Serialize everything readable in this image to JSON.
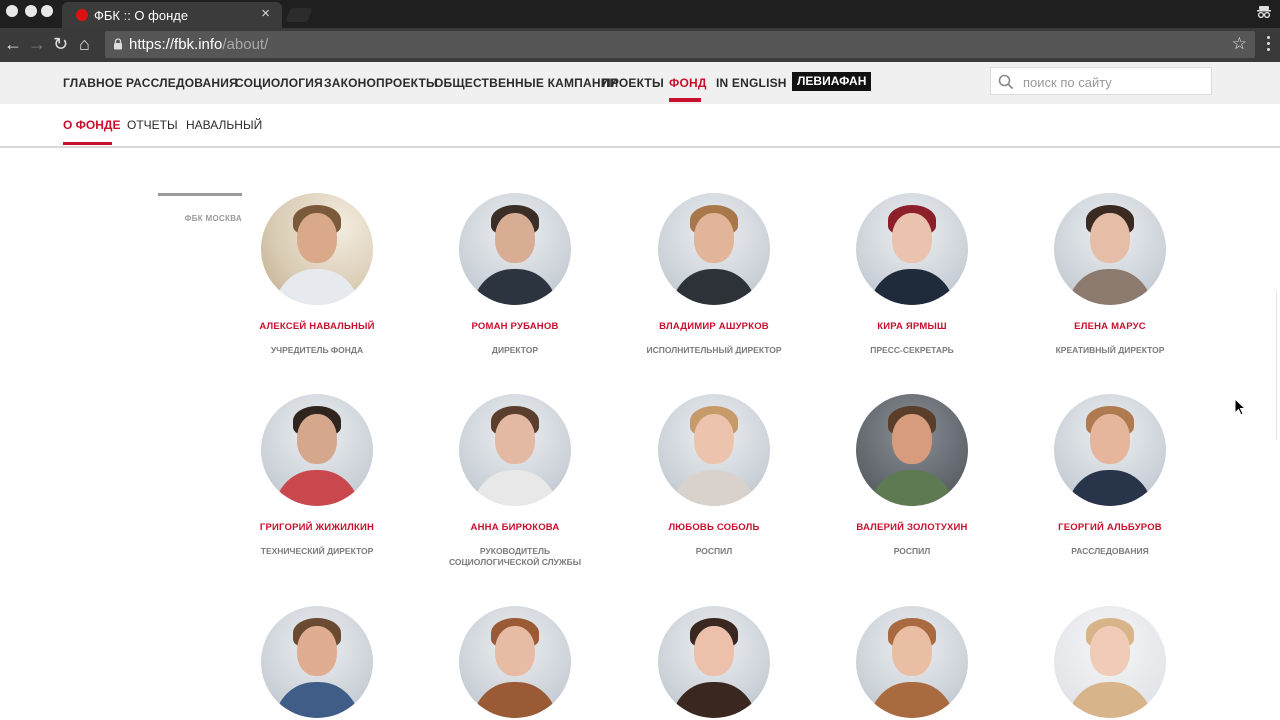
{
  "browser": {
    "tab_title": "ФБК :: О фонде",
    "tab_close": "×",
    "url_host": "https://fbk.info",
    "url_path": "/about/",
    "back": "←",
    "forward": "→",
    "reload": "↻",
    "home": "⌂",
    "star": "☆",
    "colors": {
      "chrome_dark": "#1f1f1f",
      "toolbar": "#3a3a3a",
      "omnibox": "#565656"
    }
  },
  "header": {
    "nav": [
      {
        "label": "ГЛАВНОЕ"
      },
      {
        "label": "РАССЛЕДОВАНИЯ"
      },
      {
        "label": "СОЦИОЛОГИЯ"
      },
      {
        "label": "ЗАКОНОПРОЕКТЫ"
      },
      {
        "label": "ОБЩЕСТВЕННЫЕ КАМПАНИИ"
      },
      {
        "label": "ПРОЕКТЫ"
      },
      {
        "label": "ФОНД"
      },
      {
        "label": "IN ENGLISH"
      }
    ],
    "leviathan": "ЛЕВИАФАН",
    "search_placeholder": "поиск по сайту",
    "accent": "#c8102e"
  },
  "subnav": [
    {
      "label": "О ФОНДЕ"
    },
    {
      "label": "ОТЧЕТЫ"
    },
    {
      "label": "НАВАЛЬНЫЙ"
    }
  ],
  "sidebar": {
    "label": "ФБК МОСКВА"
  },
  "team": [
    {
      "name": "АЛЕКСЕЙ НАВАЛЬНЫЙ",
      "role": "УЧРЕДИТЕЛЬ ФОНДА"
    },
    {
      "name": "РОМАН РУБАНОВ",
      "role": "ДИРЕКТОР"
    },
    {
      "name": "ВЛАДИМИР АШУРКОВ",
      "role": "ИСПОЛНИТЕЛЬНЫЙ ДИРЕКТОР"
    },
    {
      "name": "КИРА ЯРМЫШ",
      "role": "ПРЕСС-СЕКРЕТАРЬ"
    },
    {
      "name": "ЕЛЕНА МАРУС",
      "role": "КРЕАТИВНЫЙ ДИРЕКТОР"
    },
    {
      "name": "ГРИГОРИЙ ЖИЖИЛКИН",
      "role": "ТЕХНИЧЕСКИЙ ДИРЕКТОР"
    },
    {
      "name": "АННА БИРЮКОВА",
      "role": "РУКОВОДИТЕЛЬ СОЦИОЛОГИЧЕСКОЙ СЛУЖБЫ"
    },
    {
      "name": "ЛЮБОВЬ СОБОЛЬ",
      "role": "РОСПИЛ"
    },
    {
      "name": "ВАЛЕРИЙ ЗОЛОТУХИН",
      "role": "РОСПИЛ"
    },
    {
      "name": "ГЕОРГИЙ АЛЬБУРОВ",
      "role": "РАССЛЕДОВАНИЯ"
    }
  ]
}
